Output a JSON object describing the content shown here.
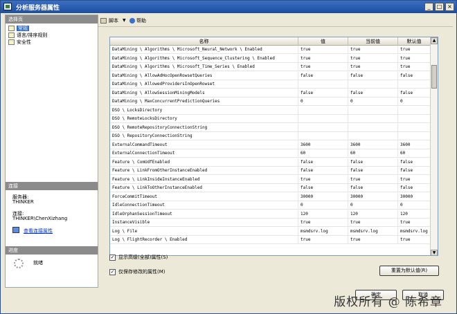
{
  "window": {
    "title": "分析服务器属性"
  },
  "title_buttons": [
    "_",
    "□",
    "×"
  ],
  "left_panel": {
    "select_page_header": "选择页",
    "nav_items": [
      "常规",
      "语言/排序规则",
      "安全性"
    ],
    "selected_nav": "常规",
    "connection_header": "连接",
    "server_label": "服务器:",
    "server_value": "THINKER",
    "connection_label": "连接:",
    "connection_value": "THINKER\\ChenXizhang",
    "view_connection_link": "查看连接属性",
    "progress_header": "进度",
    "progress_status": "就绪"
  },
  "toolbar": {
    "script_label": "脚本",
    "help_label": "帮助"
  },
  "grid": {
    "columns": [
      "名称",
      "值",
      "当前值",
      "默认值"
    ],
    "rows": [
      [
        "DataMining \\ Algorithms \\ Microsoft_Neural_Network \\ Enabled",
        "true",
        "true",
        "true"
      ],
      [
        "DataMining \\ Algorithms \\ Microsoft_Sequence_Clustering \\ Enabled",
        "true",
        "true",
        "true"
      ],
      [
        "DataMining \\ Algorithms \\ Microsoft_Time_Series \\ Enabled",
        "true",
        "true",
        "true"
      ],
      [
        "DataMining \\ AllowAdHocOpenRowsetQueries",
        "false",
        "false",
        "false"
      ],
      [
        "DataMining \\ AllowedProvidersInOpenRowset",
        "",
        "",
        ""
      ],
      [
        "DataMining \\ AllowSessionMiningModels",
        "false",
        "false",
        "false"
      ],
      [
        "DataMining \\ MaxConcurrentPredictionQueries",
        "0",
        "0",
        "0"
      ],
      [
        "DSO \\ LocksDirectory",
        "",
        "",
        ""
      ],
      [
        "DSO \\ RemoteLocksDirectory",
        "",
        "",
        ""
      ],
      [
        "DSO \\ RemoteRepositoryConnectionString",
        "",
        "",
        ""
      ],
      [
        "DSO \\ RepositoryConnectionString",
        "",
        "",
        ""
      ],
      [
        "ExternalCommandTimeout",
        "3600",
        "3600",
        "3600"
      ],
      [
        "ExternalConnectionTimeout",
        "60",
        "60",
        "60"
      ],
      [
        "Feature \\ ComUdfEnabled",
        "false",
        "false",
        "false"
      ],
      [
        "Feature \\ LinkFromOtherInstanceEnabled",
        "false",
        "false",
        "false"
      ],
      [
        "Feature \\ LinkInsideInstanceEnabled",
        "true",
        "true",
        "true"
      ],
      [
        "Feature \\ LinkToOtherInstanceEnabled",
        "false",
        "false",
        "false"
      ],
      [
        "ForceCommitTimeout",
        "30000",
        "30000",
        "30000"
      ],
      [
        "IdleConnectionTimeout",
        "0",
        "0",
        "0"
      ],
      [
        "IdleOrphanSessionTimeout",
        "120",
        "120",
        "120"
      ],
      [
        "InstanceVisible",
        "true",
        "true",
        "true"
      ],
      [
        "Log \\ File",
        "msmdsrv.log",
        "msmdsrv.log",
        "msmdsrv.log"
      ],
      [
        "Log \\ FlightRecorder \\ Enabled",
        "true",
        "true",
        "true"
      ]
    ]
  },
  "options": {
    "show_advanced": "显示高级(全部)属性(S)",
    "show_advanced_checked": true,
    "only_modified": "仅保存修改的属性(M)",
    "only_modified_checked": true,
    "reset_button": "重置为默认值(R)"
  },
  "footer": {
    "ok_button": "确定",
    "cancel_button": "取消"
  },
  "watermark": "版权所有 @ 陈希章"
}
